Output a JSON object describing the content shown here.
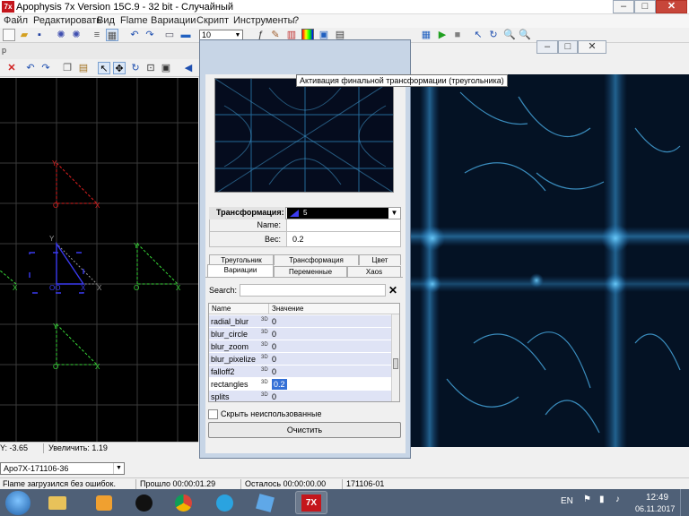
{
  "main_window": {
    "app_icon_text": "7x",
    "title": "Apophysis 7x Version 15C.9  - 32 bit - Случайный",
    "controls": [
      "–",
      "□",
      "✕"
    ]
  },
  "menu": {
    "items": [
      "Файл",
      "Редактировать",
      "Вид",
      "Flame",
      "Вариации",
      "Скрипт",
      "Инструменты",
      "?"
    ]
  },
  "toolbar": {
    "quality_value": "10"
  },
  "editor": {
    "window_caption": "р",
    "axis_labels": {
      "x": "X",
      "y": "Y",
      "o": "O"
    },
    "status": {
      "y_coord": "Y: -3.65",
      "zoom": "Увеличить: 1.19"
    }
  },
  "adjust": {
    "tooltip": "Активация финальной трансформации (треугольника)",
    "transform_label": "Трансформация:",
    "transform_value": "5",
    "name_label": "Name:",
    "name_value": "",
    "weight_label": "Вес:",
    "weight_value": "0.2",
    "tabs_row1": [
      "Треугольник",
      "Трансформация",
      "Цвет"
    ],
    "tabs_row2": [
      "Вариации",
      "Переменные",
      "Xaos"
    ],
    "active_tab": "Вариации",
    "search_label": "Search:",
    "search_value": "",
    "search_clear": "✕",
    "grid_headers": [
      "Name",
      "Значение"
    ],
    "variations": [
      {
        "name": "radial_blur",
        "mark": "3D",
        "value": "0"
      },
      {
        "name": "blur_circle",
        "mark": "3D",
        "value": "0"
      },
      {
        "name": "blur_zoom",
        "mark": "3D",
        "value": "0"
      },
      {
        "name": "blur_pixelize",
        "mark": "3D",
        "value": "0"
      },
      {
        "name": "falloff2",
        "mark": "3D",
        "value": "0"
      },
      {
        "name": "rectangles",
        "mark": "3D",
        "value": "0.2"
      },
      {
        "name": "splits",
        "mark": "3D",
        "value": "0"
      }
    ],
    "hide_unused_label": "Скрыть неиспользованные",
    "clear_button": "Очистить"
  },
  "flame_selector": {
    "value": "Apo7X-171106-36"
  },
  "statusbar": {
    "message": "Flame загрузился без ошибок.",
    "elapsed": "Прошло 00:00:01.29",
    "remaining": "Осталось 00:00:00.00",
    "id": "171106-01"
  },
  "taskbar": {
    "lang": "EN",
    "time": "12:49",
    "date": "06.11.2017",
    "app_7x_label": "7X"
  },
  "colors": {
    "render_bg": "#030816",
    "flame_blue": "#3aa4e8",
    "triangle_red": "#e02020",
    "triangle_green": "#38d838",
    "triangle_blue": "#3a3af0",
    "selection_blue": "#3470d6"
  }
}
